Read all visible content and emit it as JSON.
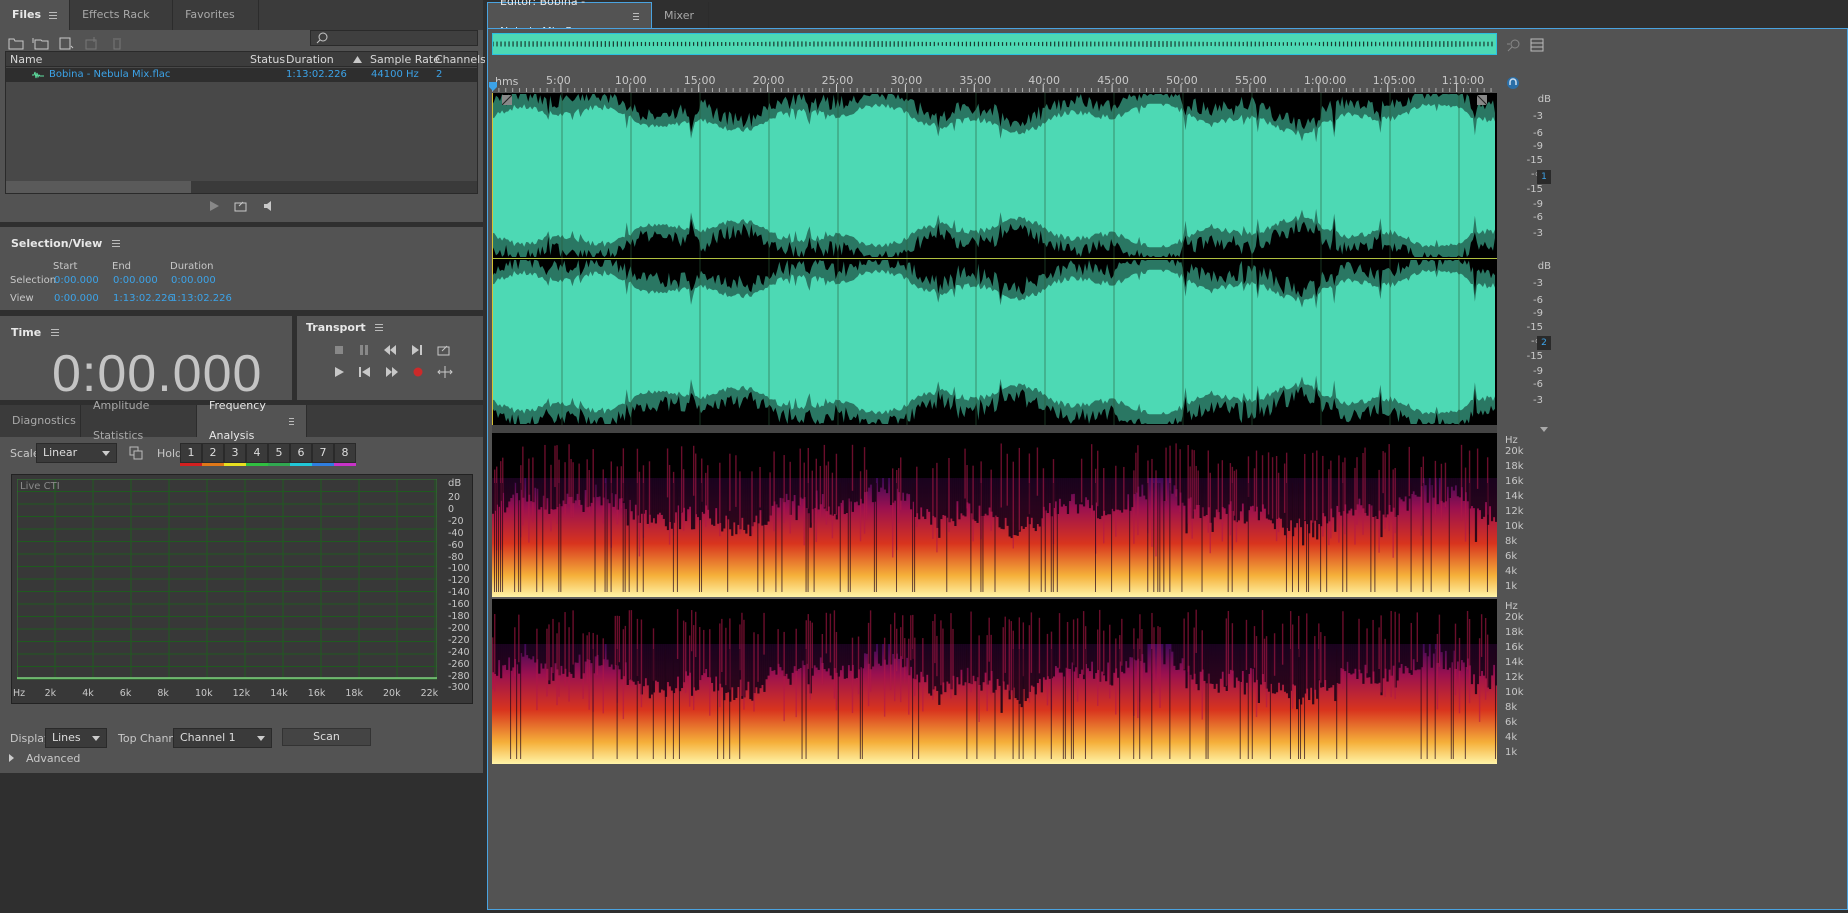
{
  "files_panel": {
    "tabs": [
      "Files",
      "Effects Rack",
      "Favorites"
    ],
    "search_placeholder": "",
    "columns": [
      "Name",
      "Status",
      "Duration",
      "Sample Rate",
      "Channels"
    ],
    "rows": [
      {
        "name": "Bobina - Nebula Mix.flac",
        "status": "",
        "duration": "1:13:02.226",
        "sample_rate": "44100 Hz",
        "channels": "2"
      }
    ]
  },
  "selection_view": {
    "title": "Selection/View",
    "col_start": "Start",
    "col_end": "End",
    "col_duration": "Duration",
    "selection_label": "Selection",
    "selection": {
      "start": "0:00.000",
      "end": "0:00.000",
      "duration": "0:00.000"
    },
    "view_label": "View",
    "view": {
      "start": "0:00.000",
      "end": "1:13:02.226",
      "duration": "1:13:02.226"
    }
  },
  "time_panel": {
    "title": "Time",
    "value": "0:00.000"
  },
  "transport": {
    "title": "Transport"
  },
  "analysis": {
    "tabs": [
      "Diagnostics",
      "Amplitude Statistics",
      "Frequency Analysis"
    ],
    "scale_label": "Scale:",
    "scale_value": "Linear",
    "hold_label": "Hold:",
    "hold": [
      {
        "n": "1",
        "color": "#d32020"
      },
      {
        "n": "2",
        "color": "#e07818"
      },
      {
        "n": "3",
        "color": "#e8e020"
      },
      {
        "n": "4",
        "color": "#30c040"
      },
      {
        "n": "5",
        "color": "#30a850"
      },
      {
        "n": "6",
        "color": "#20c8d8"
      },
      {
        "n": "7",
        "color": "#2f7ee0"
      },
      {
        "n": "8",
        "color": "#c832c8"
      }
    ],
    "graph_label": "Live CTI",
    "db_unit": "dB",
    "db_ticks": [
      "20",
      "0",
      "-20",
      "-40",
      "-60",
      "-80",
      "-100",
      "-120",
      "-140",
      "-160",
      "-180",
      "-200",
      "-220",
      "-240",
      "-260",
      "-280",
      "-300"
    ],
    "hz_ticks": [
      "Hz",
      "2k",
      "4k",
      "6k",
      "8k",
      "10k",
      "12k",
      "14k",
      "16k",
      "18k",
      "20k",
      "22k"
    ],
    "display_label": "Display:",
    "display_value": "Lines",
    "top_channel_label": "Top Channel:",
    "top_channel_value": "Channel 1",
    "scan_label": "Scan",
    "advanced_label": "Advanced"
  },
  "editor": {
    "tabs": [
      "Editor: Bobina - Nebula Mix.flac",
      "Mixer"
    ],
    "ruler_unit": "hms",
    "ruler_ticks": [
      "5:00",
      "10:00",
      "15:00",
      "20:00",
      "25:00",
      "30:00",
      "35:00",
      "40:00",
      "45:00",
      "50:00",
      "55:00",
      "1:00:00",
      "1:05:00",
      "1:10:00"
    ],
    "db_unit": "dB",
    "db_scale": [
      "-3",
      "-6",
      "-9",
      "-15",
      "-∞",
      "-15",
      "-9",
      "-6",
      "-3"
    ],
    "channel_1": "1",
    "channel_2": "2",
    "hz_unit": "Hz",
    "hz_scale": [
      "20k",
      "18k",
      "16k",
      "14k",
      "12k",
      "10k",
      "8k",
      "6k",
      "4k",
      "1k"
    ],
    "waveform_color": "#4dd9b4",
    "accent": "#3ca3e8"
  }
}
